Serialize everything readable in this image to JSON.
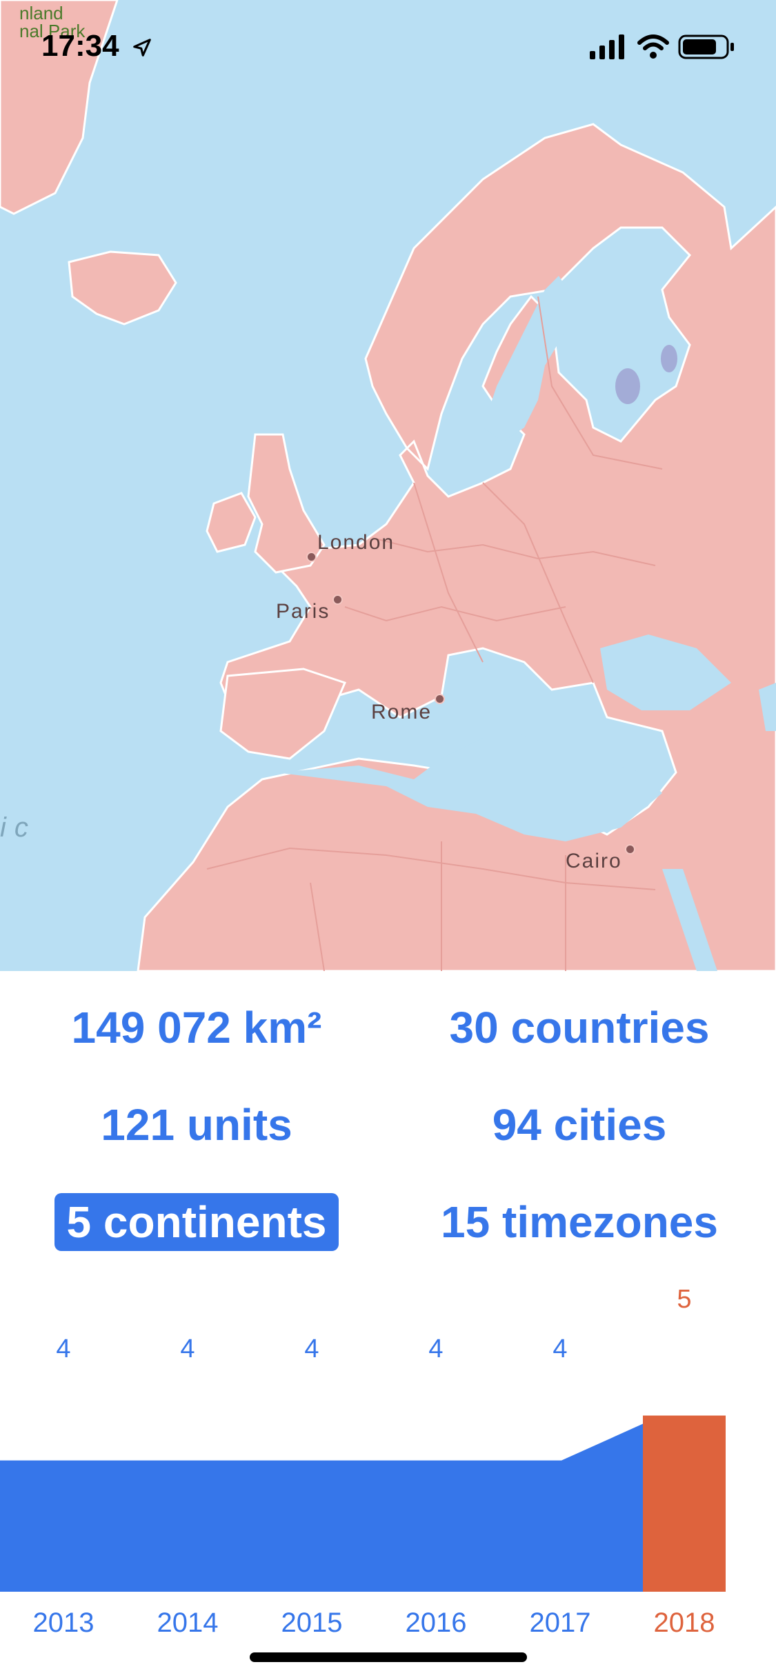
{
  "status_bar": {
    "time": "17:34",
    "location_icon": "location-arrow-icon",
    "signal_icon": "cellular-signal-icon",
    "wifi_icon": "wifi-icon",
    "battery_icon": "battery-icon"
  },
  "map": {
    "park_label_lines": [
      "nland",
      "nal Park"
    ],
    "ocean_label": "ic",
    "cities": [
      {
        "name": "London"
      },
      {
        "name": "Paris"
      },
      {
        "name": "Rome"
      },
      {
        "name": "Cairo"
      }
    ],
    "colors": {
      "water": "#b9dff3",
      "land": "#f2b9b4",
      "border": "#ffffff"
    }
  },
  "stats": [
    {
      "label": "149 072 km²",
      "selected": false
    },
    {
      "label": "30 countries",
      "selected": false
    },
    {
      "label": "121 units",
      "selected": false
    },
    {
      "label": "94 cities",
      "selected": false
    },
    {
      "label": "5 continents",
      "selected": true
    },
    {
      "label": "15 timezones",
      "selected": false
    }
  ],
  "chart_data": {
    "type": "area",
    "categories": [
      "2013",
      "2014",
      "2015",
      "2016",
      "2017",
      "2018"
    ],
    "values": [
      4,
      4,
      4,
      4,
      4,
      5
    ],
    "highlight_index": 5,
    "colors": {
      "area": "#3676ea",
      "highlight": "#de633d",
      "label": "#3676ea"
    }
  }
}
